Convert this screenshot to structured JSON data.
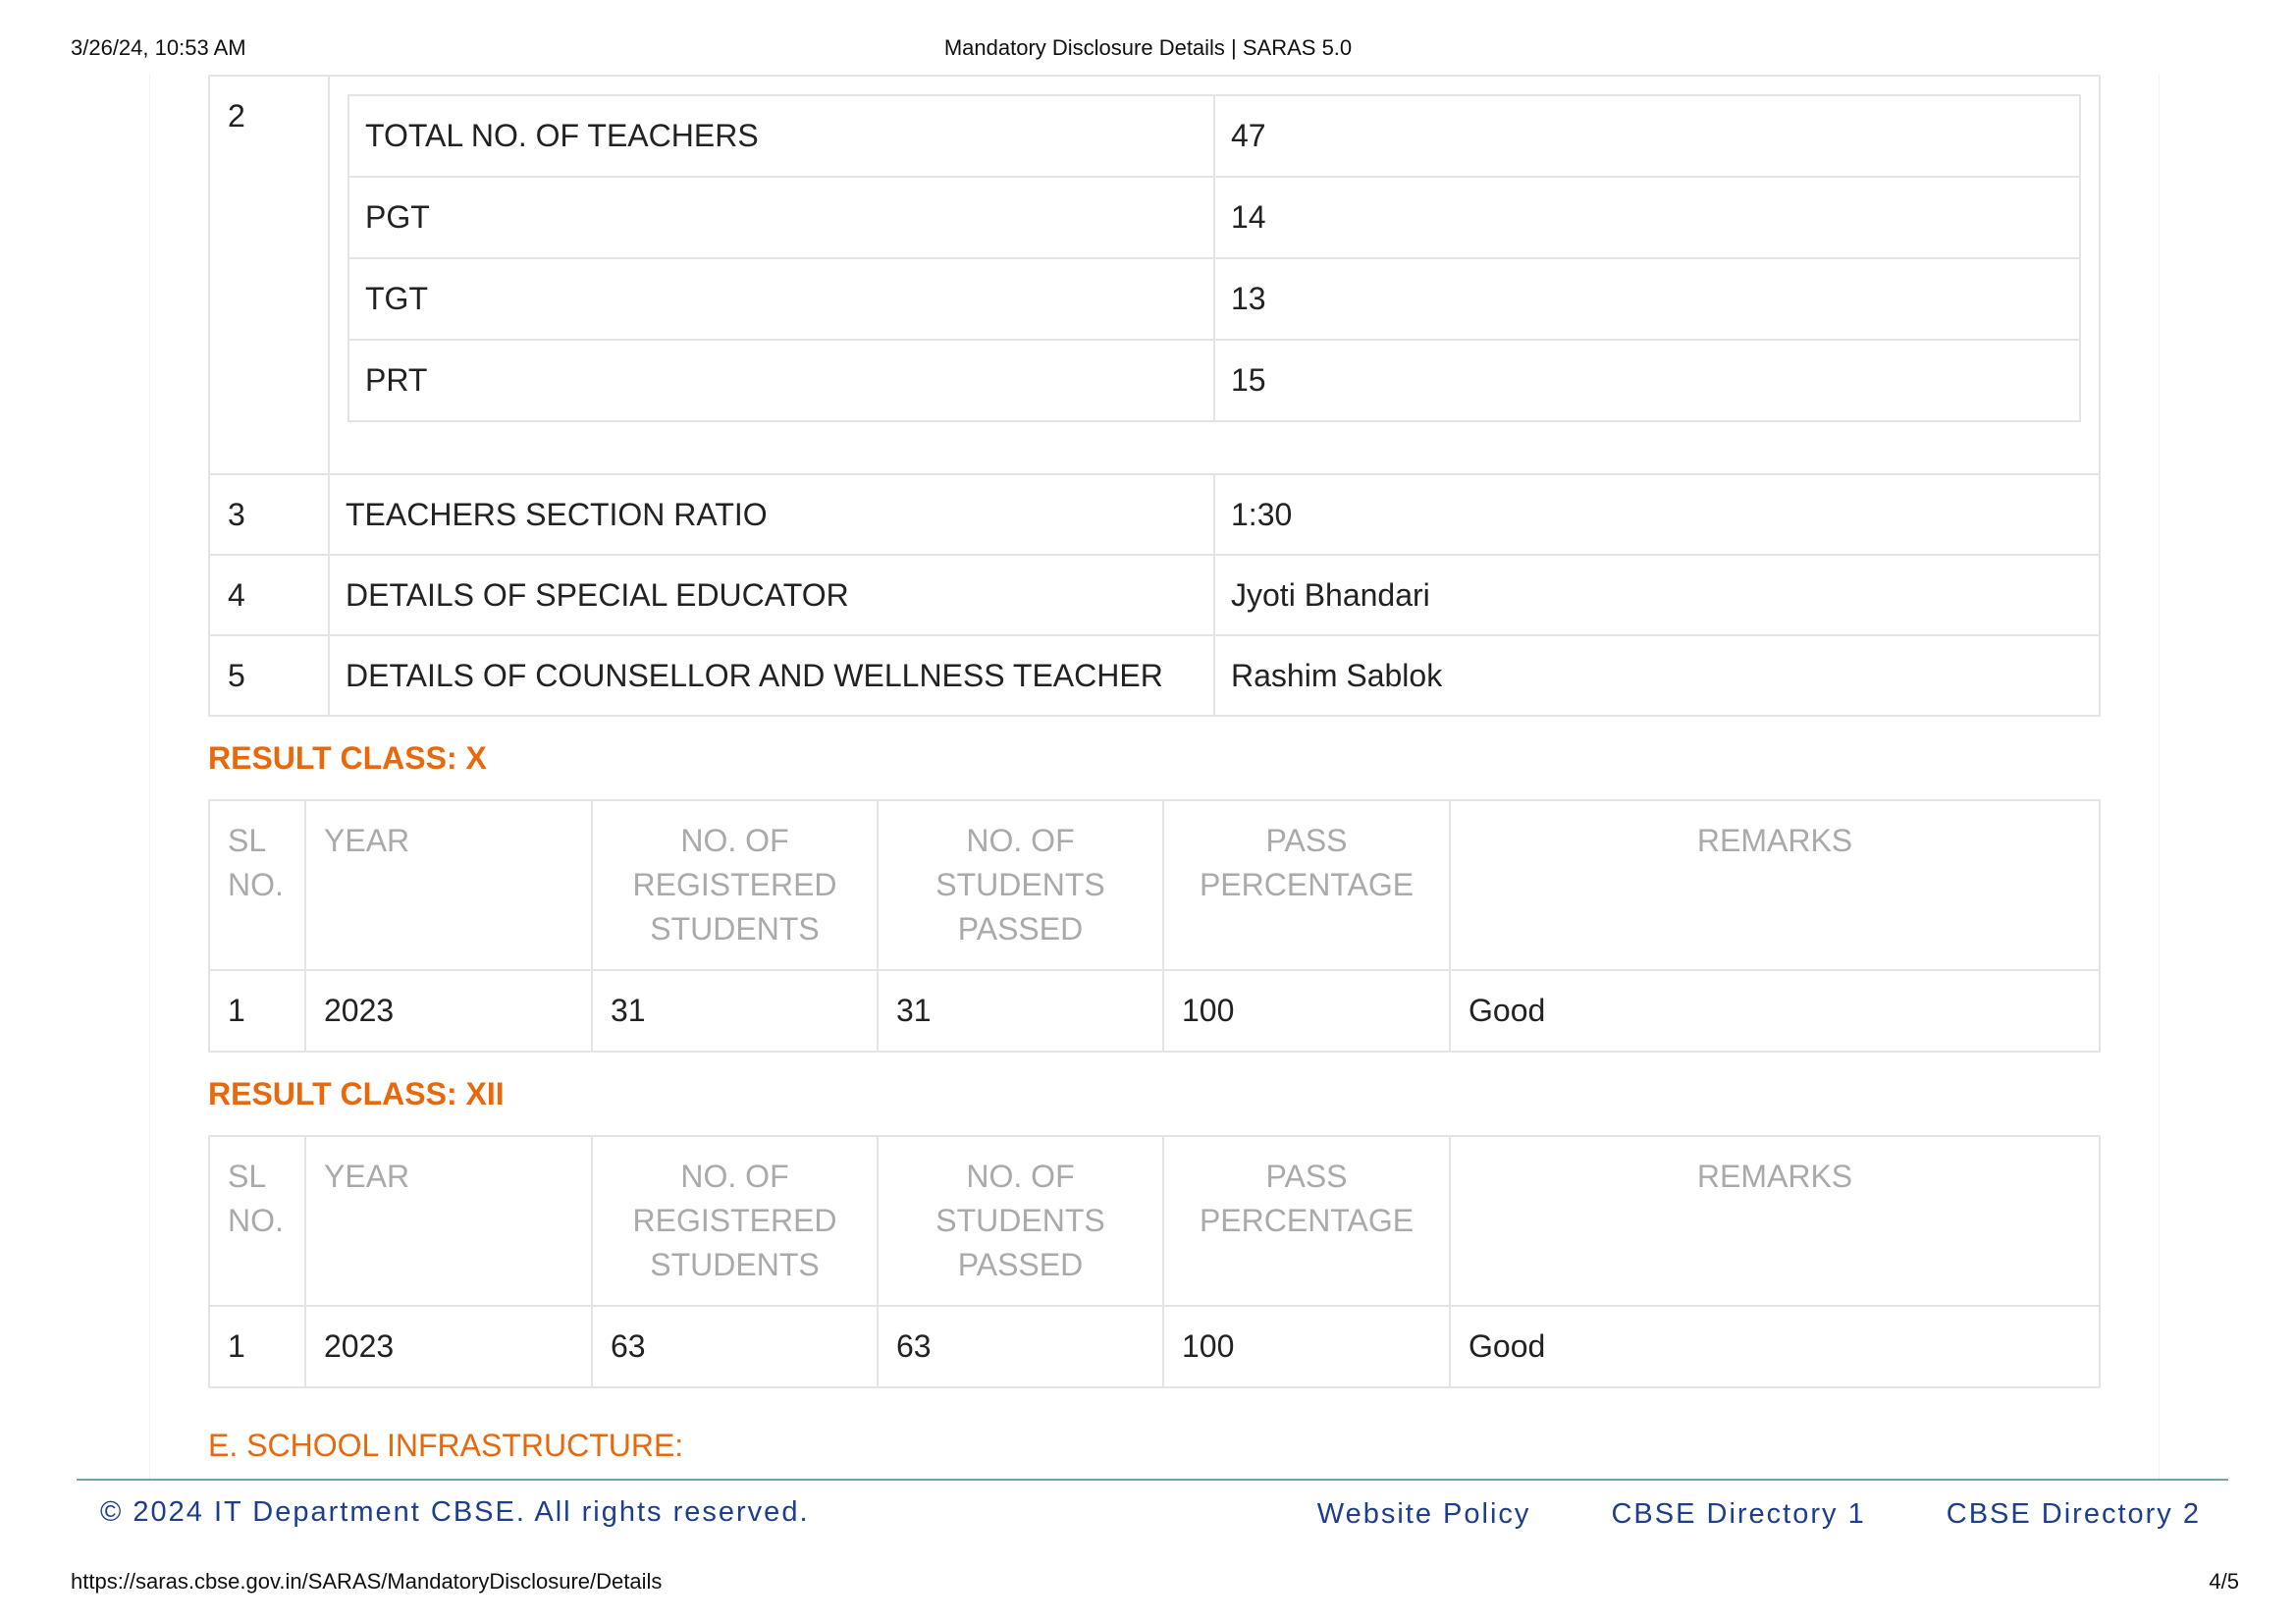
{
  "print_header": {
    "datetime": "3/26/24, 10:53 AM",
    "title": "Mandatory Disclosure Details | SARAS 5.0"
  },
  "staff_table": {
    "teachers_row": {
      "sl": "2",
      "items": [
        {
          "label": "TOTAL NO. OF TEACHERS",
          "value": "47"
        },
        {
          "label": "PGT",
          "value": "14"
        },
        {
          "label": "TGT",
          "value": "13"
        },
        {
          "label": "PRT",
          "value": "15"
        }
      ]
    },
    "rows": [
      {
        "sl": "3",
        "label": "TEACHERS SECTION RATIO",
        "value": "1:30"
      },
      {
        "sl": "4",
        "label": "DETAILS OF SPECIAL EDUCATOR",
        "value": "Jyoti Bhandari"
      },
      {
        "sl": "5",
        "label": "DETAILS OF COUNSELLOR AND WELLNESS TEACHER",
        "value": "Rashim Sablok"
      }
    ]
  },
  "result_columns": {
    "sl": "SL NO.",
    "year": "YEAR",
    "registered": "NO. OF REGISTERED STUDENTS",
    "passed": "NO. OF STUDENTS PASSED",
    "percentage": "PASS PERCENTAGE",
    "remarks": "REMARKS"
  },
  "result_x": {
    "heading": "RESULT CLASS: X",
    "row": {
      "sl": "1",
      "year": "2023",
      "registered": "31",
      "passed": "31",
      "percentage": "100",
      "remarks": "Good"
    }
  },
  "result_xii": {
    "heading": "RESULT CLASS: XII",
    "row": {
      "sl": "1",
      "year": "2023",
      "registered": "63",
      "passed": "63",
      "percentage": "100",
      "remarks": "Good"
    }
  },
  "next_section_heading": "E. SCHOOL INFRASTRUCTURE:",
  "site_footer": {
    "copyright": "© 2024 IT Department CBSE. All rights reserved.",
    "links": [
      "Website Policy",
      "CBSE Directory 1",
      "CBSE Directory 2"
    ]
  },
  "print_footer": {
    "url": "https://saras.cbse.gov.in/SARAS/MandatoryDisclosure/Details",
    "page": "4/5"
  }
}
